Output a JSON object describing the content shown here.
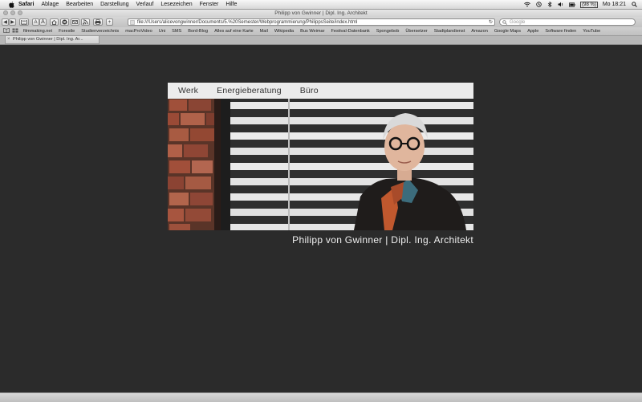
{
  "menubar": {
    "app": "Safari",
    "items": [
      "Ablage",
      "Bearbeiten",
      "Darstellung",
      "Verlauf",
      "Lesezeichen",
      "Fenster",
      "Hilfe"
    ],
    "clock": "Mo 18:21",
    "battery": "(98 %)"
  },
  "window": {
    "title": "Philipp von Gwinner | Dipl. Ing. Architekt"
  },
  "toolbar": {
    "url": "file:///Users/alicevongwinner/Documents/5.%20Semester/Webprogrammierung/PhilippsSeite/index.html",
    "search_placeholder": "Google"
  },
  "bookmarks": [
    "filmmaking.net",
    "Forestle",
    "Studienverzeichnis",
    "macProVideo",
    "Uni",
    "SMS",
    "Bord-Blog",
    "Alles auf eine Karte",
    "Mail",
    "Wikipedia",
    "Bus Weimar",
    "Festival-Datenbank",
    "Spongebob",
    "Übersetzer",
    "Stadtplandienst",
    "Amazon",
    "Google Maps",
    "Apple",
    "Software finden",
    "YouTube"
  ],
  "tab": {
    "label": "Philipp von Gwinner | Dipl. Ing. Ar..."
  },
  "site": {
    "nav": [
      "Werk",
      "Energieberatung",
      "Büro"
    ],
    "caption": "Philipp von Gwinner | Dipl. Ing. Architekt"
  },
  "colors": {
    "page_bg": "#2b2b2b",
    "nav_bg": "#ececec",
    "caption_text": "#f0f0f0"
  }
}
